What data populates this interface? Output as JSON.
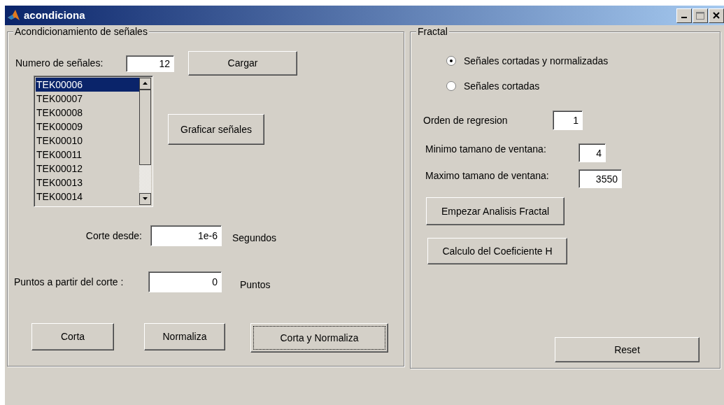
{
  "window": {
    "title": "acondiciona"
  },
  "acondicionamiento": {
    "legend": "Acondicionamiento de señales",
    "numero": {
      "label": "Numero de señales:",
      "value": "12"
    },
    "cargar": "Cargar",
    "signals": [
      {
        "label": "TEK00006",
        "selected": true
      },
      {
        "label": "TEK00007",
        "selected": false
      },
      {
        "label": "TEK00008",
        "selected": false
      },
      {
        "label": "TEK00009",
        "selected": false
      },
      {
        "label": "TEK00010",
        "selected": false
      },
      {
        "label": "TEK00011",
        "selected": false
      },
      {
        "label": "TEK00012",
        "selected": false
      },
      {
        "label": "TEK00013",
        "selected": false
      },
      {
        "label": "TEK00014",
        "selected": false
      }
    ],
    "graficar": "Graficar señales",
    "corte": {
      "label": "Corte desde:",
      "value": "1e-6",
      "unit": "Segundos"
    },
    "puntos": {
      "label": "Puntos a partir del corte :",
      "value": "0",
      "unit": "Puntos"
    },
    "buttons": [
      {
        "label": "Corta",
        "focused": false
      },
      {
        "label": "Normaliza",
        "focused": false
      },
      {
        "label": "Corta y Normaliza",
        "focused": true
      }
    ]
  },
  "fractal": {
    "legend": "Fractal",
    "radios": [
      {
        "label": "Señales cortadas y normalizadas",
        "selected": true
      },
      {
        "label": "Señales cortadas",
        "selected": false
      }
    ],
    "orden": {
      "label": "Orden de regresion",
      "value": "1"
    },
    "minimo": {
      "label": "Minimo tamano de ventana:",
      "value": "4"
    },
    "maximo": {
      "label": "Maximo tamano de ventana:",
      "value": "3550"
    },
    "empezar": "Empezar Analisis Fractal",
    "calculo": "Calculo del Coeficiente H",
    "reset": "Reset"
  }
}
